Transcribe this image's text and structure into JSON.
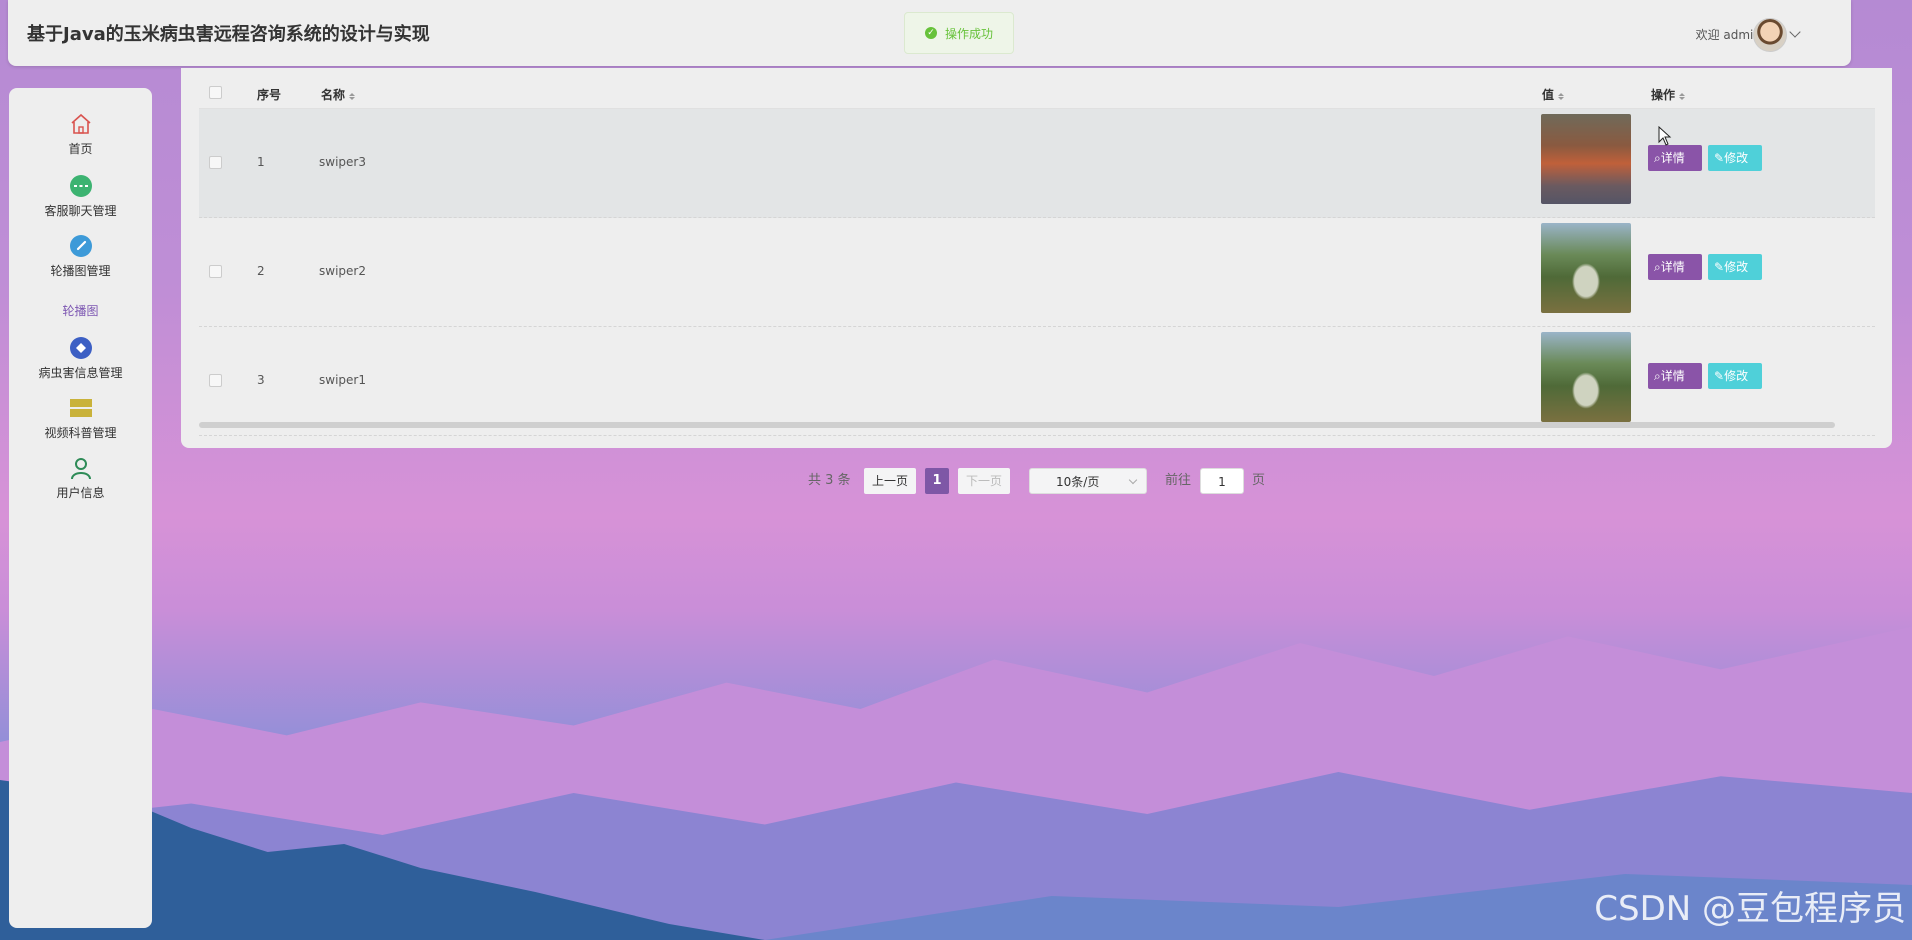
{
  "header": {
    "title": "基于Java的玉米病虫害远程咨询系统的设计与实现",
    "welcome": "欢迎 admin"
  },
  "toast": {
    "message": "操作成功"
  },
  "sidebar": {
    "items": [
      {
        "label": "首页",
        "icon": "home-icon"
      },
      {
        "label": "客服聊天管理",
        "icon": "chat-icon"
      },
      {
        "label": "轮播图管理",
        "icon": "compass-icon"
      },
      {
        "label": "病虫害信息管理",
        "icon": "diamond-icon"
      },
      {
        "label": "视频科普管理",
        "icon": "stack-icon"
      },
      {
        "label": "用户信息",
        "icon": "user-icon"
      }
    ],
    "subitem": "轮播图"
  },
  "table": {
    "columns": {
      "index": "序号",
      "name": "名称",
      "value": "值",
      "action": "操作"
    },
    "rows": [
      {
        "index": "1",
        "name": "swiper3"
      },
      {
        "index": "2",
        "name": "swiper2"
      },
      {
        "index": "3",
        "name": "swiper1"
      }
    ],
    "detail_label": "详情",
    "edit_label": "修改"
  },
  "pagination": {
    "total": "共 3 条",
    "prev": "上一页",
    "current": "1",
    "next": "下一页",
    "page_size": "10条/页",
    "goto_prefix": "前往",
    "goto_value": "1",
    "goto_suffix": "页"
  },
  "watermark": "CSDN @豆包程序员",
  "colors": {
    "accent": "#7e57a6",
    "detail": "#8a54a8",
    "edit": "#4fd0d9",
    "success": "#67c23a"
  }
}
